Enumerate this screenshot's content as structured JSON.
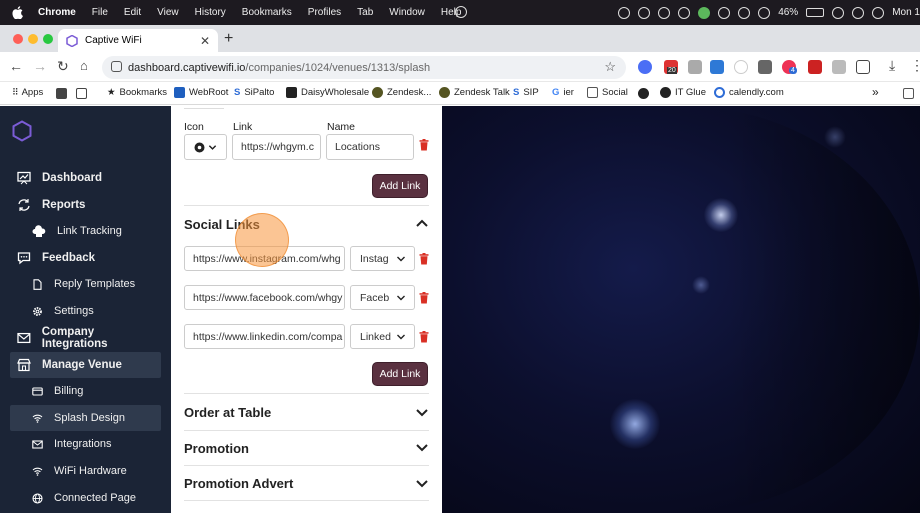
{
  "menubar": {
    "app": "Chrome",
    "items": [
      "File",
      "Edit",
      "View",
      "History",
      "Bookmarks",
      "Profiles",
      "Tab",
      "Window",
      "Help"
    ],
    "battery": "46%",
    "clock": "Mon 1"
  },
  "browser": {
    "tab_title": "Captive WiFi",
    "url_host": "dashboard.captivewifi.io",
    "url_path": "/companies/1024/venues/1313/splash",
    "ext_badge_a": "20",
    "ext_badge_b": "4"
  },
  "bookmarks": [
    "Apps",
    "Bookmarks",
    "WebRoot",
    "SiPalto",
    "DaisyWholesale",
    "Zendesk...",
    "Zendesk Talk",
    "SIP",
    "ier",
    "Social",
    "",
    "IT Glue",
    "calendly.com"
  ],
  "sidebar": {
    "items": [
      {
        "label": "Dashboard",
        "icon": "chart-board-icon"
      },
      {
        "label": "Reports",
        "icon": "refresh-icon"
      },
      {
        "label": "Link Tracking",
        "icon": "link-cloud-icon"
      },
      {
        "label": "Feedback",
        "icon": "chat-icon"
      },
      {
        "label": "Reply Templates",
        "icon": "file-icon"
      },
      {
        "label": "Settings",
        "icon": "gear-icon"
      },
      {
        "label": "Company Integrations",
        "icon": "mail-icon"
      },
      {
        "label": "Manage Venue",
        "icon": "store-icon"
      },
      {
        "label": "Billing",
        "icon": "card-icon"
      },
      {
        "label": "Splash Design",
        "icon": "wifi-icon"
      },
      {
        "label": "Integrations",
        "icon": "mail-icon"
      },
      {
        "label": "WiFi Hardware",
        "icon": "wifi-icon"
      },
      {
        "label": "Connected Page",
        "icon": "globe-icon"
      }
    ]
  },
  "links_form": {
    "icon_label": "Icon",
    "link_label": "Link",
    "name_label": "Name",
    "link_value": "https://whgym.c",
    "name_value": "Locations",
    "add_link": "Add Link"
  },
  "social": {
    "title": "Social Links",
    "rows": [
      {
        "url": "https://www.instagram.com/whg",
        "platform": "Instag"
      },
      {
        "url": "https://www.facebook.com/whgy",
        "platform": "Faceb"
      },
      {
        "url": "https://www.linkedin.com/compa",
        "platform": "Linked"
      }
    ],
    "add_link": "Add Link"
  },
  "sections": [
    "Order at Table",
    "Promotion",
    "Promotion Advert"
  ],
  "colors": {
    "sidebar_bg": "#1b2436",
    "button_bg": "#5a3140",
    "delete_red": "#d93025",
    "brand_purple": "#7b5cd6"
  }
}
